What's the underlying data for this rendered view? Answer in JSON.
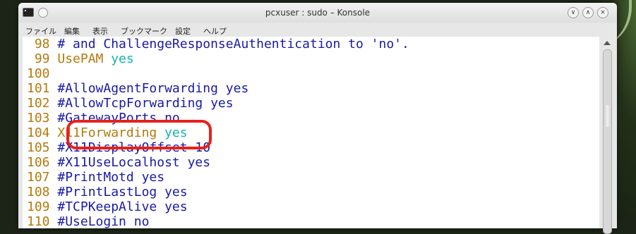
{
  "window": {
    "title": "pcxuser : sudo – Konsole",
    "minimize_glyph": "∨",
    "maximize_glyph": "∧",
    "close_glyph": "×",
    "pin_glyph": "◦"
  },
  "menu": [
    {
      "label": "ファイル"
    },
    {
      "label": "編集"
    },
    {
      "label": "表示"
    },
    {
      "label": "ブックマーク"
    },
    {
      "label": "設定"
    },
    {
      "label": "ヘルプ"
    }
  ],
  "terminal": {
    "lines": [
      {
        "num": " 98",
        "text": "# and ChallengeResponseAuthentication to 'no'.",
        "kind": "comment"
      },
      {
        "num": " 99",
        "key": "UsePAM",
        "val": "yes",
        "kind": "setting"
      },
      {
        "num": "100",
        "text": "",
        "kind": "comment"
      },
      {
        "num": "101",
        "text": "#AllowAgentForwarding yes",
        "kind": "comment"
      },
      {
        "num": "102",
        "text": "#AllowTcpForwarding yes",
        "kind": "comment"
      },
      {
        "num": "103",
        "text": "#GatewayPorts no",
        "kind": "comment"
      },
      {
        "num": "104",
        "key": "X11Forwarding",
        "val": "yes",
        "kind": "setting"
      },
      {
        "num": "105",
        "text": "#X11DisplayOffset 10",
        "kind": "comment"
      },
      {
        "num": "106",
        "text": "#X11UseLocalhost yes",
        "kind": "comment"
      },
      {
        "num": "107",
        "text": "#PrintMotd yes",
        "kind": "comment"
      },
      {
        "num": "108",
        "text": "#PrintLastLog yes",
        "kind": "comment"
      },
      {
        "num": "109",
        "text": "#TCPKeepAlive yes",
        "kind": "comment"
      },
      {
        "num": "110",
        "text": "#UseLogin no",
        "kind": "comment"
      }
    ]
  },
  "scrollbar": {
    "position_fraction": 0.3,
    "visible_fraction": 0.12
  },
  "colors": {
    "line_number": "#b5780c",
    "comment": "#1a1aa6",
    "keyword": "#b5780c",
    "value": "#18b2b2",
    "highlight": "#e8201a"
  }
}
